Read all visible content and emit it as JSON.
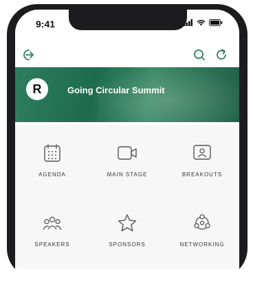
{
  "status_bar": {
    "time": "9:41"
  },
  "header": {
    "event_title": "Going Circular Summit",
    "logo_letter": "R"
  },
  "tiles": [
    {
      "label": "AGENDA",
      "icon": "calendar-icon"
    },
    {
      "label": "MAIN STAGE",
      "icon": "video-icon"
    },
    {
      "label": "BREAKOUTS",
      "icon": "breakout-icon"
    },
    {
      "label": "SPEAKERS",
      "icon": "people-icon"
    },
    {
      "label": "SPONSORS",
      "icon": "star-icon"
    },
    {
      "label": "NETWORKING",
      "icon": "network-icon"
    }
  ],
  "colors": {
    "banner": "#1e6a4e",
    "icon": "#555555",
    "accent": "#2f7e5f"
  }
}
